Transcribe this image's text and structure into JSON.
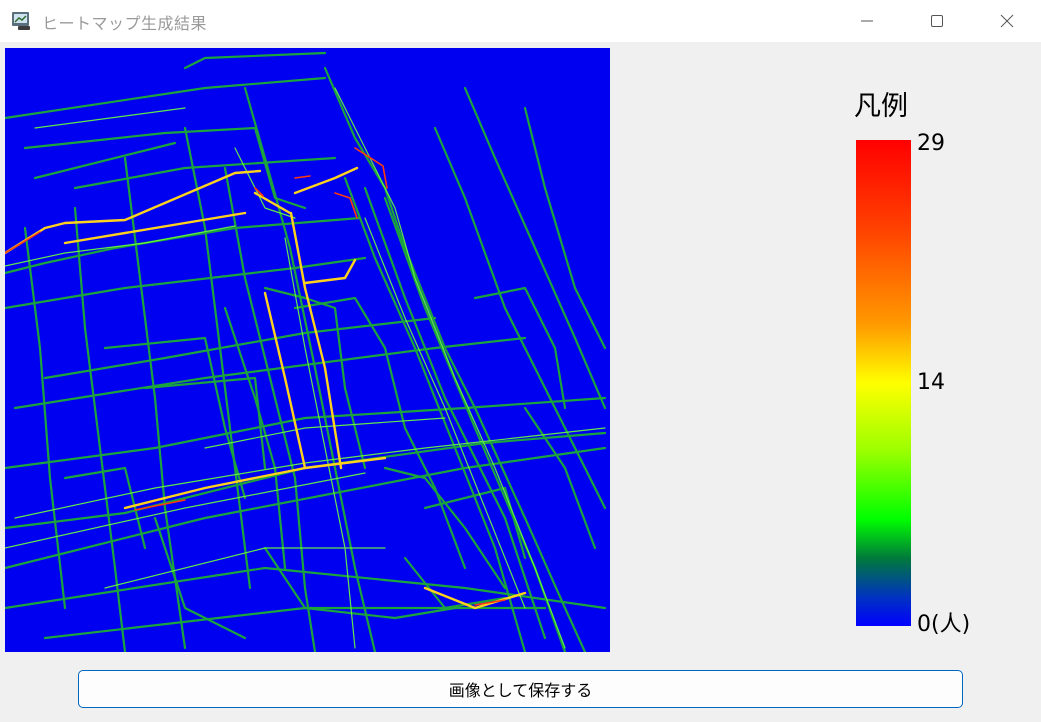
{
  "window": {
    "title": "ヒートマップ生成結果",
    "icon": "app-window-icon",
    "controls": {
      "minimize_icon": "minimize-icon",
      "maximize_icon": "maximize-icon",
      "close_icon": "close-icon"
    }
  },
  "heatmap": {
    "background_color": "#0000f0",
    "low_color": "#00c800",
    "mid_color": "#ffff00",
    "high_color": "#ff0000"
  },
  "legend": {
    "title": "凡例",
    "max_label": "29",
    "mid_label": "14",
    "min_label": "0(人)",
    "max_value": 29,
    "mid_value": 14,
    "min_value": 0,
    "gradient_colors": [
      "#ff0000",
      "#ffff00",
      "#00ff00",
      "#0000ff"
    ]
  },
  "actions": {
    "save_label": "画像として保存する"
  }
}
